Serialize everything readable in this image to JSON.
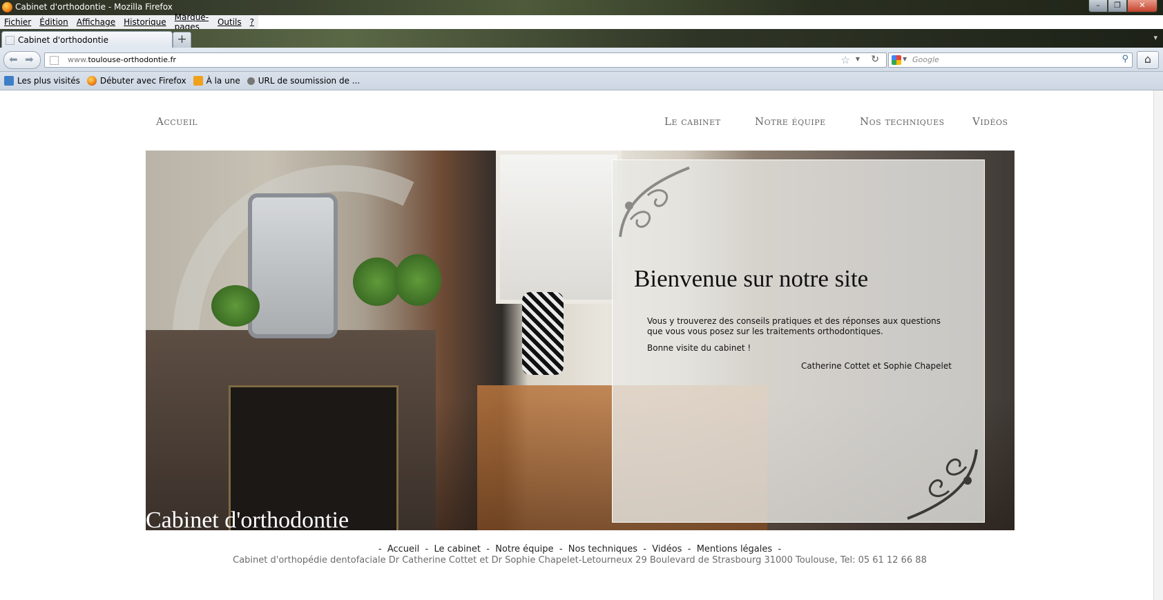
{
  "window": {
    "title": "Cabinet d'orthodontie - Mozilla Firefox",
    "controls": [
      "minimize-icon",
      "restore-icon",
      "close-icon"
    ]
  },
  "menu": [
    "Fichier",
    "Édition",
    "Affichage",
    "Historique",
    "Marque-pages",
    "Outils",
    "?"
  ],
  "tabs": [
    {
      "label": "Cabinet d'orthodontie"
    }
  ],
  "new_tab_label": "+",
  "address": {
    "prefix": "www.",
    "domain": "toulouse-orthodontie.fr"
  },
  "search": {
    "placeholder": "Google"
  },
  "bookmarks": [
    "Les plus visités",
    "Débuter avec Firefox",
    "À la une",
    "URL de soumission de ..."
  ],
  "site": {
    "nav": [
      "Accueil",
      "Le cabinet",
      "Notre équipe",
      "Nos techniques",
      "Vidéos"
    ],
    "hero_title": "Cabinet d'orthodontie",
    "welcome": {
      "heading": "Bienvenue sur notre site",
      "intro": "Vous y trouverez des conseils pratiques et des réponses aux questions que vous vous posez sur les traitements orthodontiques.",
      "closing": "Bonne visite du cabinet !",
      "signature": "Catherine Cottet et Sophie Chapelet"
    },
    "footer": {
      "links": [
        "Accueil",
        "Le cabinet",
        "Notre équipe",
        "Nos techniques",
        "Vidéos",
        "Mentions légales"
      ],
      "separator": " - ",
      "address": "Cabinet d'orthopédie dentofaciale Dr Catherine Cottet et Dr Sophie Chapelet-Letourneux 29 Boulevard de Strasbourg 31000 Toulouse, Tel: 05 61 12 66 88"
    }
  }
}
